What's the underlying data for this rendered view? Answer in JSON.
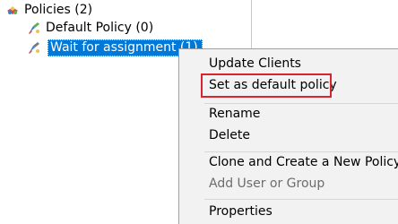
{
  "tree": {
    "root": {
      "label": "Policies (2)",
      "icon": "policies-icon"
    },
    "children": [
      {
        "label": "Default Policy (0)",
        "icon": "policy-icon"
      },
      {
        "label": "Wait for assignment (1)",
        "icon": "policy-icon",
        "selected": true
      }
    ]
  },
  "context_menu": {
    "items": [
      {
        "label": "Update Clients",
        "enabled": true
      },
      {
        "label": "Set as default policy",
        "enabled": true,
        "highlighted": true
      },
      {
        "label": "Rename",
        "enabled": true
      },
      {
        "label": "Delete",
        "enabled": true
      },
      {
        "label": "Clone and Create a New Policy",
        "enabled": true
      },
      {
        "label": "Add User or Group",
        "enabled": false
      },
      {
        "label": "Properties",
        "enabled": true
      }
    ],
    "highlight_color": "#d9232e"
  },
  "colors": {
    "selection": "#0078d7",
    "menu_background": "#f2f2f2",
    "disabled_text": "#6d6d6d"
  }
}
